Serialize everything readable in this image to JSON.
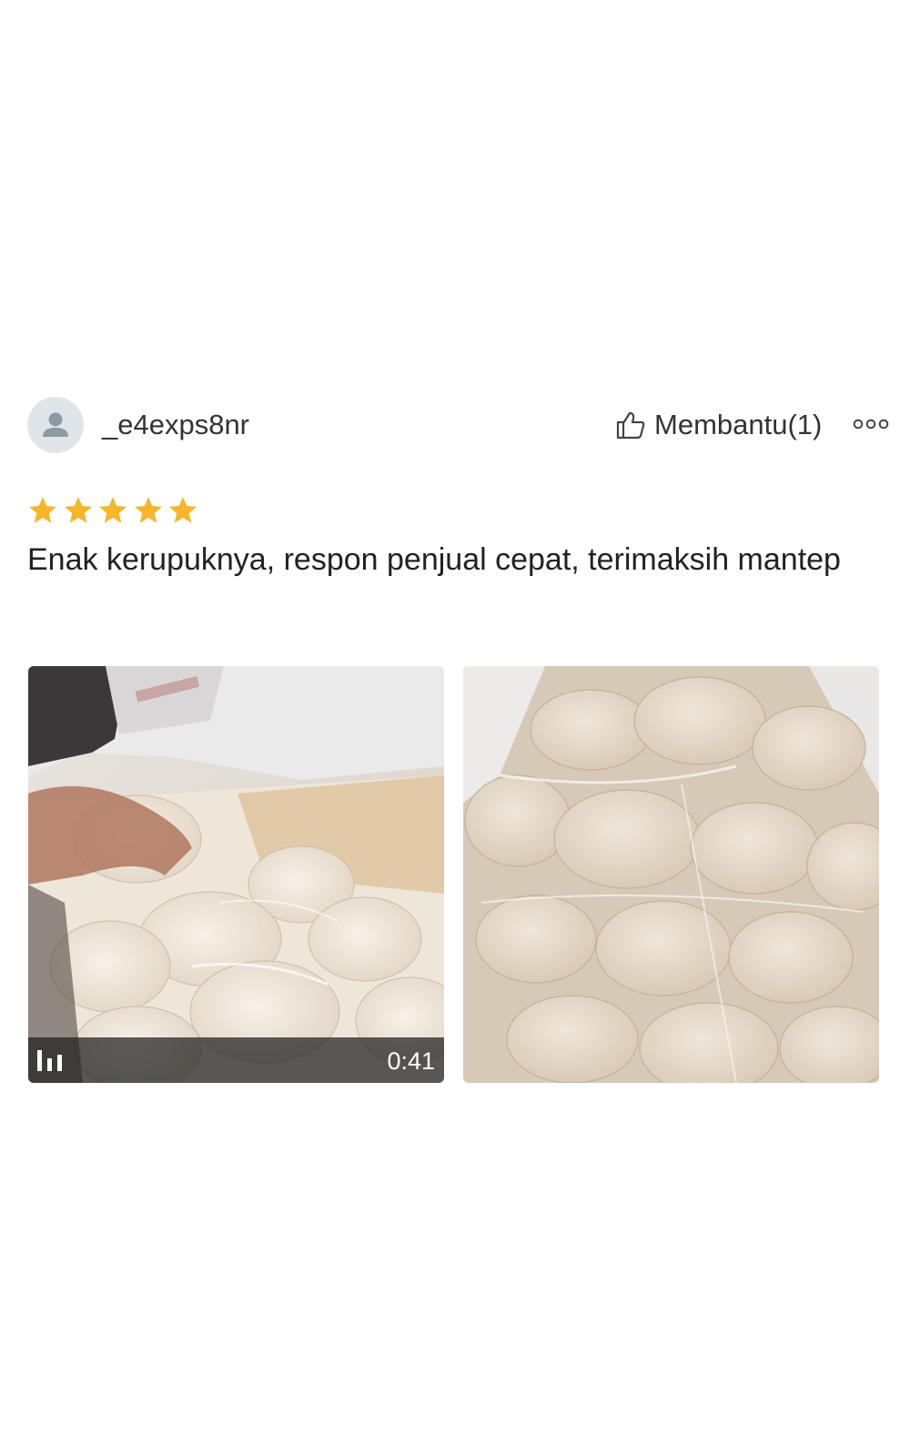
{
  "review": {
    "username": "_e4exps8nr",
    "avatar_icon": "user-avatar-icon",
    "helpful_label": "Membantu(1)",
    "helpful_icon": "thumbs-up-icon",
    "more_icon": "more-options-icon",
    "rating": 5,
    "rating_max": 5,
    "star_color": "#f6b62b",
    "text": "Enak kerupuknya, respon penjual cepat, terimaksih mantep",
    "media": [
      {
        "type": "video",
        "duration": "0:41",
        "icon": "video-bars-icon"
      },
      {
        "type": "photo"
      }
    ]
  }
}
